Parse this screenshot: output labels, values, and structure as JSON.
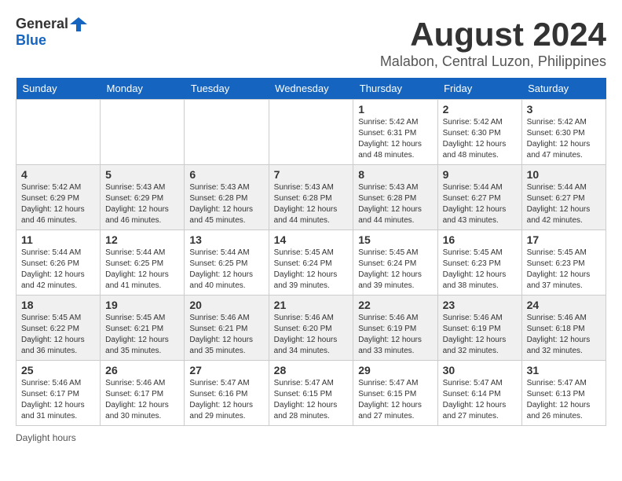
{
  "header": {
    "logo_general": "General",
    "logo_blue": "Blue",
    "month_title": "August 2024",
    "location": "Malabon, Central Luzon, Philippines"
  },
  "days_of_week": [
    "Sunday",
    "Monday",
    "Tuesday",
    "Wednesday",
    "Thursday",
    "Friday",
    "Saturday"
  ],
  "weeks": [
    [
      {
        "day": "",
        "info": ""
      },
      {
        "day": "",
        "info": ""
      },
      {
        "day": "",
        "info": ""
      },
      {
        "day": "",
        "info": ""
      },
      {
        "day": "1",
        "info": "Sunrise: 5:42 AM\nSunset: 6:31 PM\nDaylight: 12 hours\nand 48 minutes."
      },
      {
        "day": "2",
        "info": "Sunrise: 5:42 AM\nSunset: 6:30 PM\nDaylight: 12 hours\nand 48 minutes."
      },
      {
        "day": "3",
        "info": "Sunrise: 5:42 AM\nSunset: 6:30 PM\nDaylight: 12 hours\nand 47 minutes."
      }
    ],
    [
      {
        "day": "4",
        "info": "Sunrise: 5:42 AM\nSunset: 6:29 PM\nDaylight: 12 hours\nand 46 minutes."
      },
      {
        "day": "5",
        "info": "Sunrise: 5:43 AM\nSunset: 6:29 PM\nDaylight: 12 hours\nand 46 minutes."
      },
      {
        "day": "6",
        "info": "Sunrise: 5:43 AM\nSunset: 6:28 PM\nDaylight: 12 hours\nand 45 minutes."
      },
      {
        "day": "7",
        "info": "Sunrise: 5:43 AM\nSunset: 6:28 PM\nDaylight: 12 hours\nand 44 minutes."
      },
      {
        "day": "8",
        "info": "Sunrise: 5:43 AM\nSunset: 6:28 PM\nDaylight: 12 hours\nand 44 minutes."
      },
      {
        "day": "9",
        "info": "Sunrise: 5:44 AM\nSunset: 6:27 PM\nDaylight: 12 hours\nand 43 minutes."
      },
      {
        "day": "10",
        "info": "Sunrise: 5:44 AM\nSunset: 6:27 PM\nDaylight: 12 hours\nand 42 minutes."
      }
    ],
    [
      {
        "day": "11",
        "info": "Sunrise: 5:44 AM\nSunset: 6:26 PM\nDaylight: 12 hours\nand 42 minutes."
      },
      {
        "day": "12",
        "info": "Sunrise: 5:44 AM\nSunset: 6:25 PM\nDaylight: 12 hours\nand 41 minutes."
      },
      {
        "day": "13",
        "info": "Sunrise: 5:44 AM\nSunset: 6:25 PM\nDaylight: 12 hours\nand 40 minutes."
      },
      {
        "day": "14",
        "info": "Sunrise: 5:45 AM\nSunset: 6:24 PM\nDaylight: 12 hours\nand 39 minutes."
      },
      {
        "day": "15",
        "info": "Sunrise: 5:45 AM\nSunset: 6:24 PM\nDaylight: 12 hours\nand 39 minutes."
      },
      {
        "day": "16",
        "info": "Sunrise: 5:45 AM\nSunset: 6:23 PM\nDaylight: 12 hours\nand 38 minutes."
      },
      {
        "day": "17",
        "info": "Sunrise: 5:45 AM\nSunset: 6:23 PM\nDaylight: 12 hours\nand 37 minutes."
      }
    ],
    [
      {
        "day": "18",
        "info": "Sunrise: 5:45 AM\nSunset: 6:22 PM\nDaylight: 12 hours\nand 36 minutes."
      },
      {
        "day": "19",
        "info": "Sunrise: 5:45 AM\nSunset: 6:21 PM\nDaylight: 12 hours\nand 35 minutes."
      },
      {
        "day": "20",
        "info": "Sunrise: 5:46 AM\nSunset: 6:21 PM\nDaylight: 12 hours\nand 35 minutes."
      },
      {
        "day": "21",
        "info": "Sunrise: 5:46 AM\nSunset: 6:20 PM\nDaylight: 12 hours\nand 34 minutes."
      },
      {
        "day": "22",
        "info": "Sunrise: 5:46 AM\nSunset: 6:19 PM\nDaylight: 12 hours\nand 33 minutes."
      },
      {
        "day": "23",
        "info": "Sunrise: 5:46 AM\nSunset: 6:19 PM\nDaylight: 12 hours\nand 32 minutes."
      },
      {
        "day": "24",
        "info": "Sunrise: 5:46 AM\nSunset: 6:18 PM\nDaylight: 12 hours\nand 32 minutes."
      }
    ],
    [
      {
        "day": "25",
        "info": "Sunrise: 5:46 AM\nSunset: 6:17 PM\nDaylight: 12 hours\nand 31 minutes."
      },
      {
        "day": "26",
        "info": "Sunrise: 5:46 AM\nSunset: 6:17 PM\nDaylight: 12 hours\nand 30 minutes."
      },
      {
        "day": "27",
        "info": "Sunrise: 5:47 AM\nSunset: 6:16 PM\nDaylight: 12 hours\nand 29 minutes."
      },
      {
        "day": "28",
        "info": "Sunrise: 5:47 AM\nSunset: 6:15 PM\nDaylight: 12 hours\nand 28 minutes."
      },
      {
        "day": "29",
        "info": "Sunrise: 5:47 AM\nSunset: 6:15 PM\nDaylight: 12 hours\nand 27 minutes."
      },
      {
        "day": "30",
        "info": "Sunrise: 5:47 AM\nSunset: 6:14 PM\nDaylight: 12 hours\nand 27 minutes."
      },
      {
        "day": "31",
        "info": "Sunrise: 5:47 AM\nSunset: 6:13 PM\nDaylight: 12 hours\nand 26 minutes."
      }
    ]
  ],
  "footer": {
    "daylight_label": "Daylight hours"
  }
}
